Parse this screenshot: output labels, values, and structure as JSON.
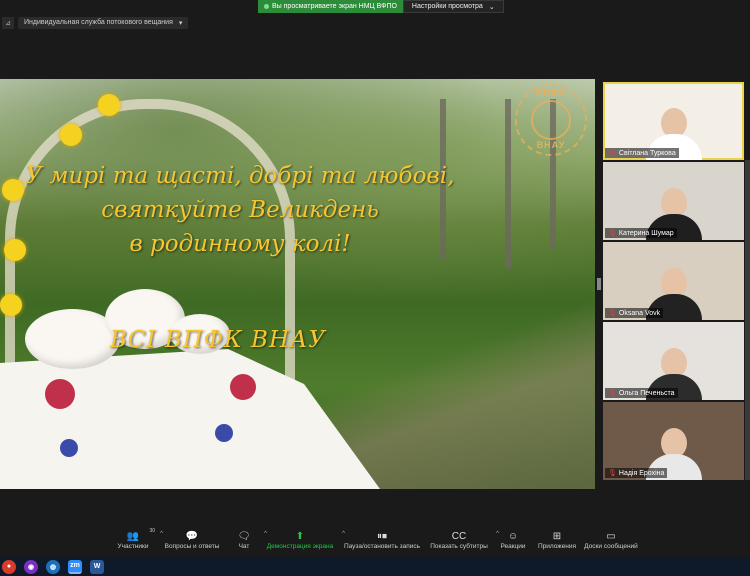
{
  "banner": {
    "sharing_text": "Вы просматриваете экран НМЦ ВФПО",
    "view_options": "Настройки просмотра"
  },
  "stream": {
    "label": "Индивидуальная служба потокового вещания"
  },
  "shared": {
    "greeting_line1": "У мирі та щасті, добрі та любові,",
    "greeting_line2": "святкуйте Великдень",
    "greeting_line3": "в родинному колі!",
    "signature": "ВСІ ВПФК ВНАУ",
    "logo_top": "ВПФК",
    "logo_bottom": "ВНАУ"
  },
  "participants": [
    {
      "name": "Світлана Туркова",
      "active": true,
      "bg": "#f3eee6",
      "shirt": "#ffffff"
    },
    {
      "name": "Катерина Шумар",
      "active": false,
      "bg": "#d9d4cc",
      "shirt": "#1f1f1f"
    },
    {
      "name": "Oksana Vovk",
      "active": false,
      "bg": "#d8cfc0",
      "shirt": "#222222"
    },
    {
      "name": "Ольга Печеньста",
      "active": false,
      "bg": "#e5e2de",
      "shirt": "#2c2c2c"
    },
    {
      "name": "Надія Ерохіна",
      "active": false,
      "bg": "#6f5a4a",
      "shirt": "#e8e8e8"
    }
  ],
  "toolbar": {
    "participants_label": "Участники",
    "participants_count": "30",
    "qa_label": "Вопросы и ответы",
    "chat_label": "Чат",
    "share_label": "Демонстрация экрана",
    "record_label": "Пауза/остановить запись",
    "captions_label": "Показать субтитры",
    "reactions_label": "Реакции",
    "apps_label": "Приложения",
    "whiteboard_label": "Доски сообщений"
  },
  "icons": {
    "participants": "participants-icon",
    "qa": "qa-icon",
    "chat": "chat-icon",
    "share": "share-screen-icon",
    "record": "pause-stop-record-icon",
    "captions": "captions-icon",
    "reactions": "reactions-icon",
    "apps": "apps-icon",
    "whiteboard": "whiteboard-icon"
  },
  "colors": {
    "accent_green": "#28c346",
    "greeting": "#f6c531",
    "active_speaker": "#e8d34a"
  }
}
